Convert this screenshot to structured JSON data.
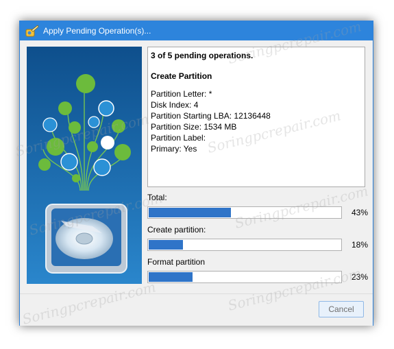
{
  "window": {
    "title": "Apply Pending Operation(s)..."
  },
  "details": {
    "count_text": "3 of 5 pending operations.",
    "operation_title": "Create Partition",
    "properties": [
      "Partition Letter: *",
      "Disk Index: 4",
      "Partition Starting LBA: 12136448",
      "Partition Size: 1534 MB",
      "Partition Label:",
      "Primary: Yes"
    ]
  },
  "progress": [
    {
      "label": "Total:",
      "value": 43,
      "percent_text": "43%"
    },
    {
      "label": "Create partition:",
      "value": 18,
      "percent_text": "18%"
    },
    {
      "label": "Format partition",
      "value": 23,
      "percent_text": "23%"
    }
  ],
  "footer": {
    "cancel_label": "Cancel"
  },
  "watermark": {
    "text": "Soringpcrepair.com"
  },
  "colors": {
    "titlebar": "#2d84dc",
    "progress_fill": "#2f74c8",
    "banner_background": "#1c67a8",
    "banner_accent": "#6cbb3c"
  },
  "icons": [
    "partition-wizard-app-icon",
    "hard-disk-illustration"
  ]
}
